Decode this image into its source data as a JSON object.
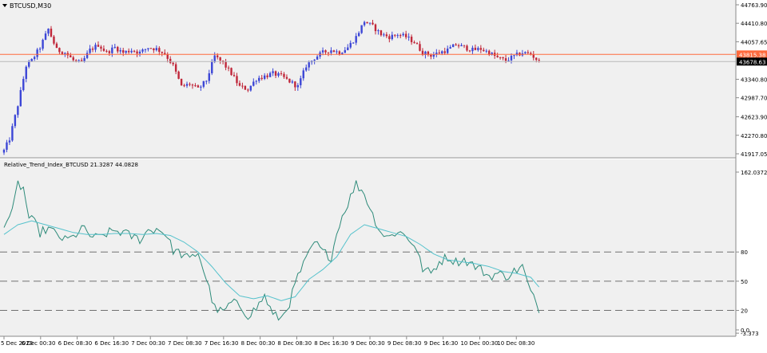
{
  "window": {
    "symbol_label": "BTCUSD,M30",
    "menu_arrow_icon": "dropdown-triangle-icon"
  },
  "colors": {
    "background": "#f0f0f0",
    "border": "#8a8a8a",
    "bull": "#3c46d6",
    "bear": "#c0273a",
    "ask_line": "#ff6a3d",
    "bid_line": "#b8b8b8",
    "indicator": "#2e8b7a",
    "signal": "#55c2cc",
    "level_line": "#707070"
  },
  "chart_data": [
    {
      "type": "candlestick",
      "title": "BTCUSD,M30",
      "ylim": [
        41917.0,
        44763.9
      ],
      "yticks": [
        "44763.90",
        "44410.80",
        "44057.65",
        "43340.80",
        "42987.70",
        "42623.90",
        "42270.80",
        "41917.05"
      ],
      "price_tags": [
        {
          "name": "ask",
          "label": "43815.38",
          "value": 43815.38
        },
        {
          "name": "bid",
          "label": "43678.63",
          "value": 43678.63
        }
      ],
      "close_anchors": [
        [
          0,
          41980
        ],
        [
          2,
          42200
        ],
        [
          5,
          42850
        ],
        [
          8,
          43600
        ],
        [
          10,
          43700
        ],
        [
          13,
          43950
        ],
        [
          16,
          44300
        ],
        [
          19,
          43900
        ],
        [
          22,
          43850
        ],
        [
          25,
          43700
        ],
        [
          28,
          43650
        ],
        [
          31,
          43900
        ],
        [
          34,
          44000
        ],
        [
          37,
          43850
        ],
        [
          40,
          43950
        ],
        [
          43,
          43850
        ],
        [
          46,
          43900
        ],
        [
          49,
          43850
        ],
        [
          52,
          43950
        ],
        [
          55,
          43920
        ],
        [
          58,
          43830
        ],
        [
          61,
          43600
        ],
        [
          64,
          43200
        ],
        [
          67,
          43250
        ],
        [
          70,
          43150
        ],
        [
          73,
          43320
        ],
        [
          76,
          43780
        ],
        [
          79,
          43650
        ],
        [
          82,
          43450
        ],
        [
          85,
          43200
        ],
        [
          88,
          43150
        ],
        [
          91,
          43350
        ],
        [
          94,
          43400
        ],
        [
          97,
          43450
        ],
        [
          100,
          43400
        ],
        [
          103,
          43300
        ],
        [
          106,
          43200
        ],
        [
          109,
          43600
        ],
        [
          112,
          43750
        ],
        [
          115,
          43850
        ],
        [
          118,
          43900
        ],
        [
          121,
          43850
        ],
        [
          124,
          43950
        ],
        [
          127,
          44150
        ],
        [
          130,
          44450
        ],
        [
          133,
          44350
        ],
        [
          136,
          44200
        ],
        [
          139,
          44150
        ],
        [
          142,
          44200
        ],
        [
          145,
          44150
        ],
        [
          148,
          44050
        ],
        [
          151,
          43850
        ],
        [
          154,
          43800
        ],
        [
          157,
          43850
        ],
        [
          160,
          43900
        ],
        [
          163,
          44000
        ],
        [
          166,
          43950
        ],
        [
          169,
          43900
        ],
        [
          172,
          43920
        ],
        [
          175,
          43850
        ],
        [
          178,
          43750
        ],
        [
          181,
          43700
        ],
        [
          184,
          43780
        ],
        [
          187,
          43850
        ],
        [
          190,
          43820
        ],
        [
          193,
          43680
        ]
      ],
      "x_tick_labels": [
        "5 Dec 2023",
        "6 Dec 00:30",
        "6 Dec 08:30",
        "6 Dec 16:30",
        "7 Dec 00:30",
        "7 Dec 08:30",
        "7 Dec 16:30",
        "8 Dec 00:30",
        "8 Dec 08:30",
        "8 Dec 16:30",
        "9 Dec 00:30",
        "9 Dec 08:30",
        "9 Dec 16:30",
        "10 Dec 00:30",
        "10 Dec 08:30"
      ],
      "grid": false
    },
    {
      "type": "line",
      "title": "Relative_Trend_Index_BTCUSD 21.3287 44.0828",
      "ylim": [
        0,
        162.0372
      ],
      "yticks": [
        "162.0372",
        "80",
        "50",
        "20",
        "0.0",
        "-3.373"
      ],
      "levels": [
        80,
        50,
        20
      ],
      "series": [
        {
          "role": "indicator",
          "anchors": [
            [
              0,
              110
            ],
            [
              3,
              120
            ],
            [
              5,
              150
            ],
            [
              7,
              145
            ],
            [
              9,
              115
            ],
            [
              11,
              110
            ],
            [
              13,
              100
            ],
            [
              16,
              104
            ],
            [
              19,
              98
            ],
            [
              22,
              92
            ],
            [
              25,
              95
            ],
            [
              28,
              105
            ],
            [
              31,
              97
            ],
            [
              34,
              94
            ],
            [
              37,
              99
            ],
            [
              40,
              102
            ],
            [
              43,
              100
            ],
            [
              46,
              96
            ],
            [
              49,
              93
            ],
            [
              52,
              102
            ],
            [
              55,
              104
            ],
            [
              58,
              100
            ],
            [
              61,
              82
            ],
            [
              64,
              78
            ],
            [
              67,
              72
            ],
            [
              70,
              80
            ],
            [
              73,
              52
            ],
            [
              76,
              22
            ],
            [
              79,
              18
            ],
            [
              82,
              28
            ],
            [
              85,
              25
            ],
            [
              88,
              15
            ],
            [
              91,
              22
            ],
            [
              94,
              35
            ],
            [
              97,
              15
            ],
            [
              100,
              12
            ],
            [
              103,
              28
            ],
            [
              106,
              55
            ],
            [
              109,
              72
            ],
            [
              112,
              90
            ],
            [
              115,
              80
            ],
            [
              118,
              75
            ],
            [
              121,
              110
            ],
            [
              124,
              130
            ],
            [
              127,
              150
            ],
            [
              130,
              140
            ],
            [
              133,
              118
            ],
            [
              136,
              100
            ],
            [
              139,
              95
            ],
            [
              142,
              102
            ],
            [
              145,
              96
            ],
            [
              148,
              88
            ],
            [
              151,
              63
            ],
            [
              154,
              58
            ],
            [
              157,
              70
            ],
            [
              160,
              75
            ],
            [
              163,
              70
            ],
            [
              166,
              72
            ],
            [
              169,
              67
            ],
            [
              172,
              62
            ],
            [
              175,
              55
            ],
            [
              178,
              58
            ],
            [
              181,
              55
            ],
            [
              184,
              60
            ],
            [
              187,
              65
            ],
            [
              190,
              38
            ],
            [
              193,
              22
            ]
          ]
        },
        {
          "role": "signal",
          "anchors": [
            [
              0,
              98
            ],
            [
              5,
              108
            ],
            [
              10,
              112
            ],
            [
              15,
              108
            ],
            [
              20,
              104
            ],
            [
              25,
              100
            ],
            [
              30,
              98
            ],
            [
              35,
              98
            ],
            [
              40,
              99
            ],
            [
              45,
              99
            ],
            [
              50,
              98
            ],
            [
              55,
              99
            ],
            [
              60,
              97
            ],
            [
              65,
              90
            ],
            [
              70,
              80
            ],
            [
              75,
              65
            ],
            [
              80,
              48
            ],
            [
              85,
              35
            ],
            [
              90,
              32
            ],
            [
              95,
              35
            ],
            [
              100,
              30
            ],
            [
              105,
              34
            ],
            [
              110,
              52
            ],
            [
              115,
              62
            ],
            [
              120,
              75
            ],
            [
              125,
              98
            ],
            [
              130,
              108
            ],
            [
              135,
              104
            ],
            [
              140,
              100
            ],
            [
              145,
              96
            ],
            [
              150,
              88
            ],
            [
              155,
              78
            ],
            [
              160,
              72
            ],
            [
              165,
              70
            ],
            [
              170,
              68
            ],
            [
              175,
              65
            ],
            [
              180,
              60
            ],
            [
              185,
              58
            ],
            [
              190,
              54
            ],
            [
              193,
              44
            ]
          ]
        }
      ],
      "grid": false
    }
  ]
}
